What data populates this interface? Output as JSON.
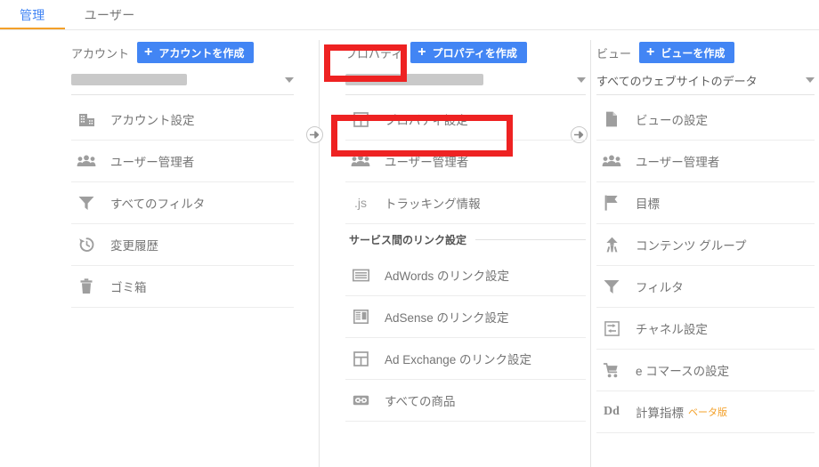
{
  "tabs": [
    {
      "label": "管理",
      "active": true
    },
    {
      "label": "ユーザー",
      "active": false
    }
  ],
  "colors": {
    "accent_blue": "#4285f4",
    "tab_underline_orange": "#f3a029",
    "beta_orange": "#f3a029",
    "highlight_red": "#ee2222",
    "text_gray": "#757575",
    "redaction_gray": "#c9c9c9"
  },
  "columns": {
    "account": {
      "label": "アカウント",
      "create_button": "アカウントを作成",
      "selector_value": "",
      "selector_redacted": true,
      "items": [
        {
          "icon": "building-icon",
          "label": "アカウント設定"
        },
        {
          "icon": "people-icon",
          "label": "ユーザー管理者"
        },
        {
          "icon": "filter-icon",
          "label": "すべてのフィルタ"
        },
        {
          "icon": "history-icon",
          "label": "変更履歴"
        },
        {
          "icon": "trash-icon",
          "label": "ゴミ箱"
        }
      ]
    },
    "property": {
      "label": "プロパティ",
      "create_button": "プロパティを作成",
      "selector_value": "",
      "selector_redacted": true,
      "items": [
        {
          "icon": "property-icon",
          "label": "プロパティ設定",
          "highlighted": true
        },
        {
          "icon": "people-icon",
          "label": "ユーザー管理者"
        },
        {
          "icon": "js-icon",
          "label": "トラッキング情報"
        }
      ],
      "section": {
        "title": "サービス間のリンク設定",
        "items": [
          {
            "icon": "adwords-icon",
            "label": "AdWords のリンク設定"
          },
          {
            "icon": "adsense-icon",
            "label": "AdSense のリンク設定"
          },
          {
            "icon": "adexchange-icon",
            "label": "Ad Exchange のリンク設定"
          },
          {
            "icon": "link-icon",
            "label": "すべての商品"
          }
        ]
      }
    },
    "view": {
      "label": "ビュー",
      "create_button": "ビューを作成",
      "selector_value": "すべてのウェブサイトのデータ",
      "selector_redacted": false,
      "items": [
        {
          "icon": "document-icon",
          "label": "ビューの設定"
        },
        {
          "icon": "people-icon",
          "label": "ユーザー管理者"
        },
        {
          "icon": "flag-icon",
          "label": "目標"
        },
        {
          "icon": "content-group-icon",
          "label": "コンテンツ グループ"
        },
        {
          "icon": "filter-icon",
          "label": "フィルタ"
        },
        {
          "icon": "channel-icon",
          "label": "チャネル設定"
        },
        {
          "icon": "cart-icon",
          "label": "e コマースの設定"
        },
        {
          "icon": "dd-icon",
          "label": "計算指標",
          "badge": "ベータ版"
        }
      ]
    }
  },
  "annotations": [
    {
      "name": "property-label-highlight",
      "target": "プロパティ"
    },
    {
      "name": "property-settings-highlight",
      "target": "プロパティ設定"
    }
  ]
}
